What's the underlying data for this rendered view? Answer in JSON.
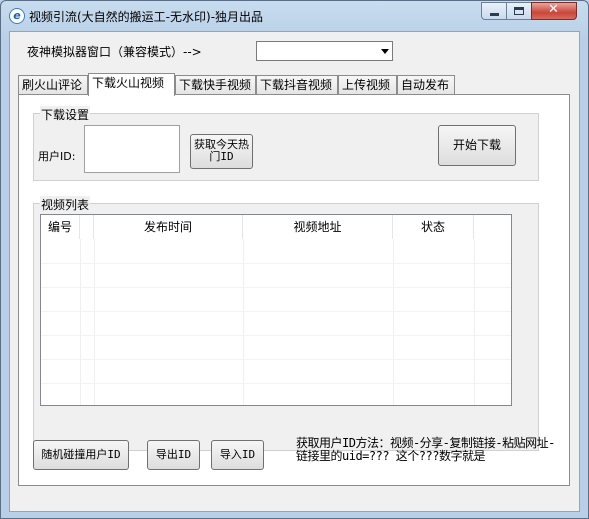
{
  "window": {
    "title": "视频引流(大自然的搬运工-无水印)-独月出品"
  },
  "emulator": {
    "label": "夜神模拟器窗口（兼容模式）-->",
    "selected": ""
  },
  "tabs": [
    {
      "label": "刷火山评论"
    },
    {
      "label": "下载火山视频"
    },
    {
      "label": "下载快手视频"
    },
    {
      "label": "下载抖音视频"
    },
    {
      "label": "上传视频"
    },
    {
      "label": "自动发布"
    }
  ],
  "download_settings": {
    "group_title": "下载设置",
    "user_id_label": "用户ID:",
    "user_id_value": "",
    "fetch_hot_button": "获取今天热门ID",
    "start_download_button": "开始下载"
  },
  "video_list": {
    "group_title": "视频列表",
    "columns": [
      "编号",
      "发布时间",
      "视频地址",
      "状态"
    ],
    "rows": []
  },
  "footer": {
    "random_button": "随机碰撞用户ID",
    "export_button": "导出ID",
    "import_button": "导入ID",
    "tip": "获取用户ID方法：视频-分享-复制链接-粘贴网址-链接里的uid=???  这个???数字就是"
  }
}
